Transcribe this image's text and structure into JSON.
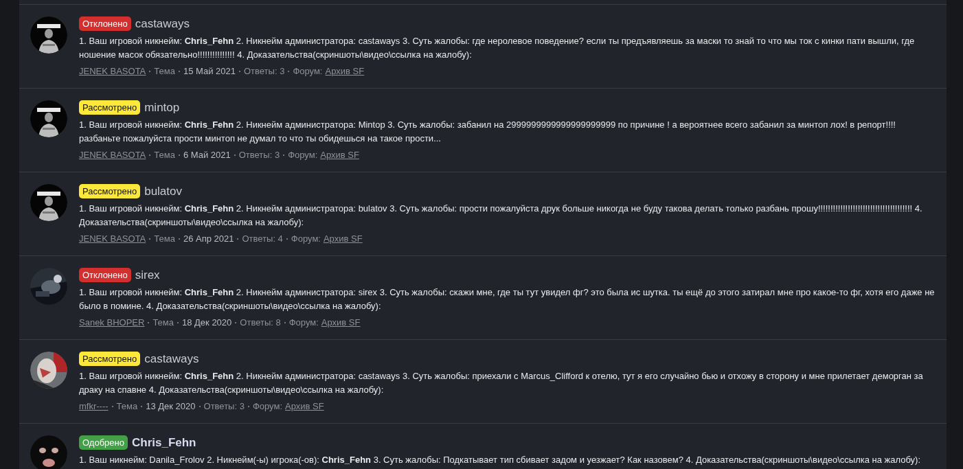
{
  "threads": [
    {
      "status": {
        "label": "Отклонено",
        "kind": "rejected"
      },
      "title": "castaways",
      "highlighted": false,
      "summary": "1. Ваш игровой никнейм: **Chris_Fehn** 2. Никнейм администратора: castaways 3. Суть жалобы: где неролевое поведение? если ты предъявляешь за маски то знай то что мы ток с кинки пати вышли, где ношение масок обязательно!!!!!!!!!!!!!!! 4. Доказательства(скриншоты\\видео\\ссылка на жалобу):",
      "meta": {
        "author": "JENEK BASOTA",
        "type": "Тема",
        "date": "15 Май 2021",
        "replies": "Ответы: 3",
        "forum_label": "Форум:",
        "forum": "Архив SF"
      }
    },
    {
      "status": {
        "label": "Рассмотрено",
        "kind": "reviewed"
      },
      "title": "mintop",
      "highlighted": false,
      "summary": "1. Ваш игровой никнейм: **Chris_Fehn** 2. Никнейм администратора: Mintop 3. Суть жалобы: забанил на 2999999999999999999999 по причине ! а вероятнее всего забанил за минтоп лох! в репорт!!!! разбаньте пожалуйста прости минтоп не думал то что ты обидешься на такое прости...",
      "meta": {
        "author": "JENEK BASOTA",
        "type": "Тема",
        "date": "6 Май 2021",
        "replies": "Ответы: 3",
        "forum_label": "Форум:",
        "forum": "Архив SF"
      }
    },
    {
      "status": {
        "label": "Рассмотрено",
        "kind": "reviewed"
      },
      "title": "bulatov",
      "highlighted": false,
      "summary": "1. Ваш игровой никнейм: **Chris_Fehn** 2. Никнейм администратора: bulatov 3. Суть жалобы: прости пожалуйста друк больше никогда не буду такова делать только разбань прошу!!!!!!!!!!!!!!!!!!!!!!!!!!!!!!!!!!!!!! 4. Доказательства(скриншоты\\видео\\ссылка на жалобу):",
      "meta": {
        "author": "JENEK BASOTA",
        "type": "Тема",
        "date": "26 Апр 2021",
        "replies": "Ответы: 4",
        "forum_label": "Форум:",
        "forum": "Архив SF"
      }
    },
    {
      "status": {
        "label": "Отклонено",
        "kind": "rejected"
      },
      "title": "sirex",
      "highlighted": false,
      "summary": "1. Ваш игровой никнейм: **Chris_Fehn** 2. Никнейм администратора: sirex 3. Суть жалобы: скажи мне, где ты тут увидел фг? это была ис шутка. ты ещё до этого затирал мне про какое-то фг, хотя его даже не было в помине. 4. Доказательства(скриншоты\\видео\\ссылка на жалобу):",
      "meta": {
        "author": "Sanek BHOPER",
        "type": "Тема",
        "date": "18 Дек 2020",
        "replies": "Ответы: 8",
        "forum_label": "Форум:",
        "forum": "Архив SF"
      }
    },
    {
      "status": {
        "label": "Рассмотрено",
        "kind": "reviewed"
      },
      "title": "castaways",
      "highlighted": false,
      "summary": "1. Ваш игровой никнейм: **Chris_Fehn** 2. Никнейм администратора: castaways 3. Суть жалобы: приехали с Marcus_Clifford к отелю, тут я его случайно бью и отхожу в сторону и мне прилетает деморган за драку на спавне 4. Доказательства(скриншоты\\видео\\ссылка на жалобу):",
      "meta": {
        "author": "mfkr----",
        "type": "Тема",
        "date": "13 Дек 2020",
        "replies": "Ответы: 3",
        "forum_label": "Форум:",
        "forum": "Архив SF"
      }
    },
    {
      "status": {
        "label": "Одобрено",
        "kind": "approved"
      },
      "title": "Chris_Fehn",
      "highlighted": true,
      "summary": "1. Ваш никнейм: Danila_Frolov 2. Никнейм(-ы) игрока(-ов): **Chris_Fehn** 3. Суть жалобы: Подкатывает тип сбивает задом и уезжает? Как назовем? 4. Доказательства(скриншоты\\видео\\ссылка на жалобу):"
    }
  ]
}
